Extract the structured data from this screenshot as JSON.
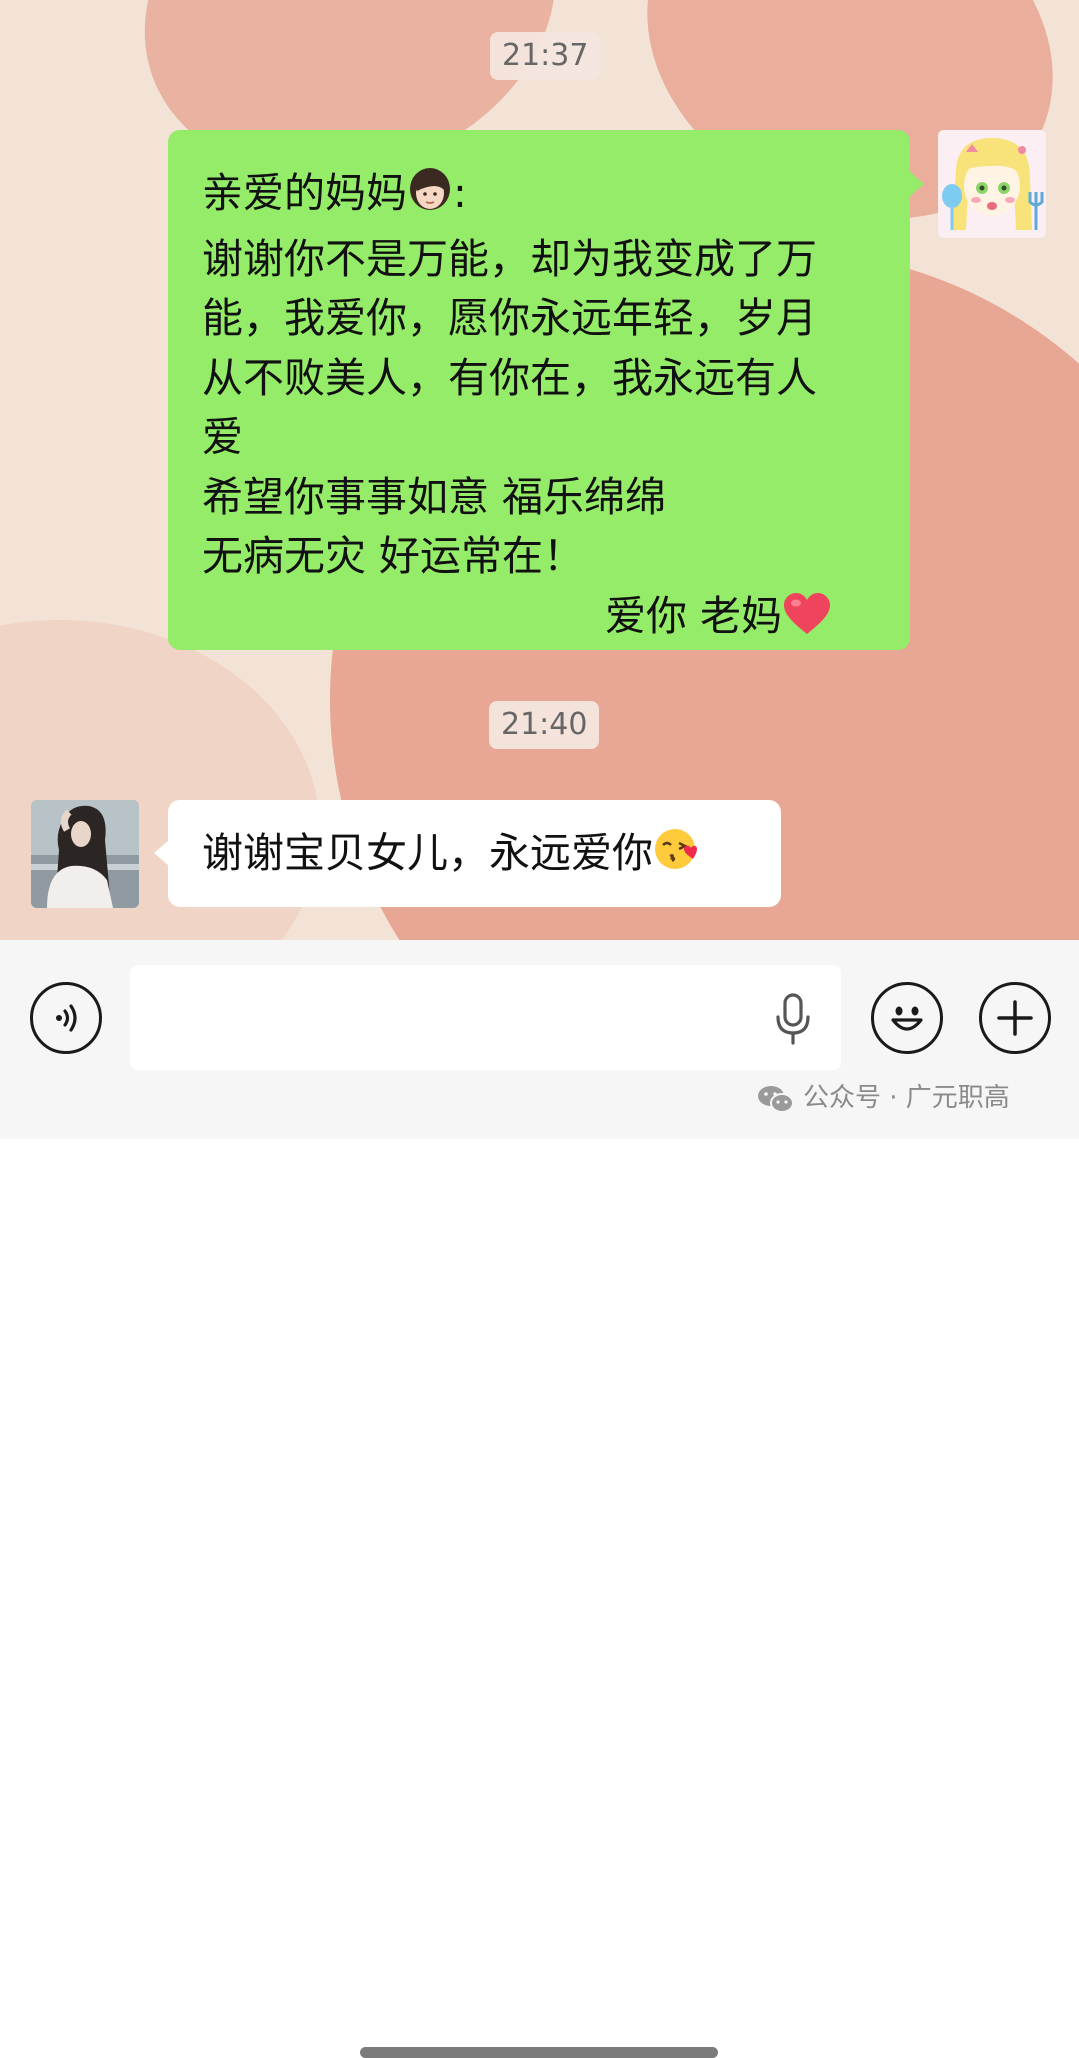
{
  "chat": {
    "time_1": "21:37",
    "time_2": "21:40",
    "sent_message": {
      "lines": [
        "亲爱的妈妈",
        ":",
        "谢谢你不是万能，却为我变成了万",
        "能，我爱你，愿你永远年轻，岁月",
        "从不败美人，有你在，我永远有人",
        "爱",
        "希望你事事如意 福乐绵绵",
        "无病无灾 好运常在！"
      ],
      "signature": "爱你  老妈",
      "emoji_1": "woman-face-emoji",
      "emoji_2": "red-heart-emoji"
    },
    "received_message": {
      "text": "谢谢宝贝女儿，永远爱你",
      "emoji": "face-blowing-kiss-emoji"
    }
  },
  "input_bar": {
    "placeholder": "",
    "icons": [
      "voice-icon",
      "microphone-icon",
      "emoji-icon",
      "plus-icon"
    ]
  },
  "watermark": {
    "text": "公众号 · 广元职高",
    "icon": "wechat-icon"
  },
  "colors": {
    "sent_bubble": "#95ec69",
    "received_bubble": "#ffffff",
    "background": "#f3e3d6",
    "accent_blob": "#e5a08d"
  }
}
